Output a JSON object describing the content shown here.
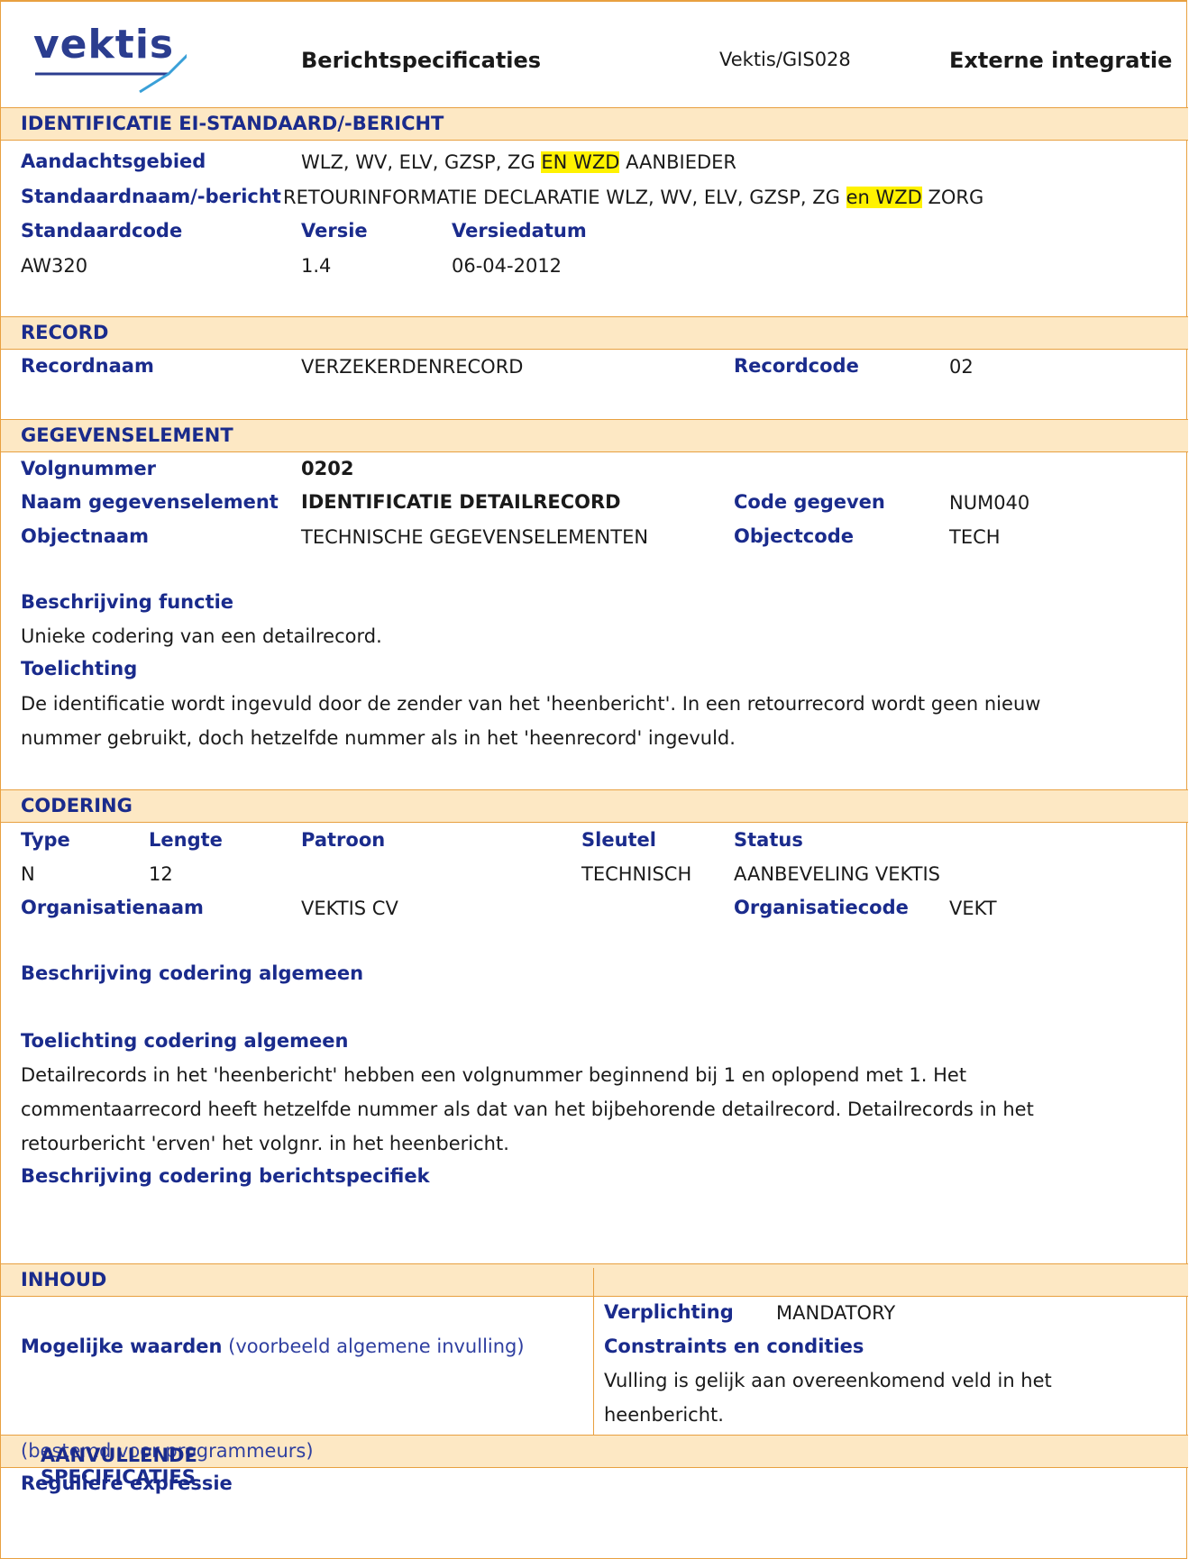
{
  "header": {
    "logo_text": "vektis",
    "title": "Berichtspecificaties",
    "code": "Vektis/GIS028",
    "right": "Externe integratie"
  },
  "identificatie": {
    "band": "IDENTIFICATIE EI-STANDAARD/-BERICHT",
    "aandachtsgebied_label": "Aandachtsgebied",
    "aandachtsgebied_pre": "WLZ, WV, ELV, GZSP, ZG ",
    "aandachtsgebied_hl": "EN WZD",
    "aandachtsgebied_post": " AANBIEDER",
    "standaardnaam_label": "Standaardnaam/-bericht",
    "standaardnaam_pre": "RETOURINFORMATIE DECLARATIE WLZ, WV, ELV, GZSP, ZG ",
    "standaardnaam_hl": "en WZD",
    "standaardnaam_post": " ZORG",
    "standaardcode_label": "Standaardcode",
    "versie_label": "Versie",
    "versiedatum_label": "Versiedatum",
    "standaardcode": "AW320",
    "versie": "1.4",
    "versiedatum": "06-04-2012"
  },
  "record": {
    "band": "RECORD",
    "recordnaam_label": "Recordnaam",
    "recordnaam": "VERZEKERDENRECORD",
    "recordcode_label": "Recordcode",
    "recordcode": "02"
  },
  "gegevenselement": {
    "band": "GEGEVENSELEMENT",
    "volgnummer_label": "Volgnummer",
    "volgnummer": "0202",
    "naam_label": "Naam gegevenselement",
    "naam": "IDENTIFICATIE DETAILRECORD",
    "code_label": "Code gegeven",
    "code": "NUM040",
    "objectnaam_label": "Objectnaam",
    "objectnaam": "TECHNISCHE GEGEVENSELEMENTEN",
    "objectcode_label": "Objectcode",
    "objectcode": "TECH",
    "beschrijving_label": "Beschrijving functie",
    "beschrijving": "Unieke codering van een detailrecord.",
    "toelichting_label": "Toelichting",
    "toelichting_line1": "De identificatie wordt ingevuld door de zender van het 'heenbericht'. In een retourrecord wordt geen nieuw",
    "toelichting_line2": "nummer gebruikt, doch hetzelfde nummer als in het 'heenrecord' ingevuld."
  },
  "codering": {
    "band": "CODERING",
    "type_label": "Type",
    "lengte_label": "Lengte",
    "patroon_label": "Patroon",
    "sleutel_label": "Sleutel",
    "status_label": "Status",
    "type": "N",
    "lengte": "12",
    "sleutel": "TECHNISCH",
    "status": "AANBEVELING VEKTIS",
    "organisatienaam_label": "Organisatienaam",
    "organisatienaam": "VEKTIS CV",
    "organisatiecode_label": "Organisatiecode",
    "organisatiecode": "VEKT",
    "beschrijving_algemeen_label": "Beschrijving codering algemeen",
    "toelichting_algemeen_label": "Toelichting codering algemeen",
    "toelichting_line1": "Detailrecords in het 'heenbericht' hebben een volgnummer beginnend bij 1 en oplopend met 1. Het",
    "toelichting_line2": "commentaarrecord heeft hetzelfde nummer als dat van het bijbehorende detailrecord. Detailrecords in het",
    "toelichting_line3": "retourbericht 'erven' het volgnr. in het heenbericht.",
    "berichtspecifiek_label": "Beschrijving codering berichtspecifiek"
  },
  "inhoud": {
    "band": "INHOUD",
    "mogelijke_label": "Mogelijke waarden",
    "mogelijke_sub": " (voorbeeld algemene invulling)",
    "verplichting_label": "Verplichting",
    "verplichting": "MANDATORY",
    "constraints_label": "Constraints en condities",
    "constraints_line1": "Vulling is gelijk aan overeenkomend veld in het",
    "constraints_line2": "heenbericht."
  },
  "aanvullend": {
    "band": "AANVULLENDE SPECIFICATIES",
    "band_sub": " (bestemd voor programmeurs)",
    "regex_label": "Reguliere expressie"
  },
  "colors": {
    "accent": "#e8a040",
    "band_bg": "#fde8c4",
    "label": "#1a2b8c",
    "highlight": "#fff200"
  }
}
